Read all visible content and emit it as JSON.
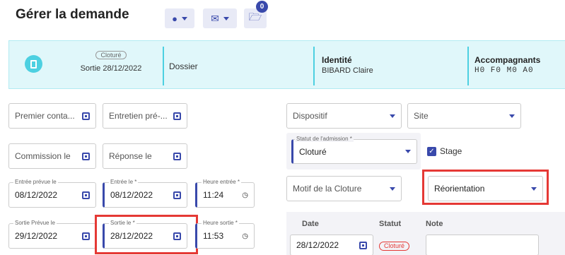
{
  "header": {
    "title": "Gérer la demande",
    "badge_count": "0"
  },
  "summary": {
    "status_chip": "Cloturé",
    "exit_text": "Sortie 28/12/2022",
    "dossier_label": "Dossier",
    "identity_label": "Identité",
    "identity_value": "BIBARD Claire",
    "companions_label": "Accompagnants",
    "companions_value": "H0 F0 M0 A0"
  },
  "form": {
    "premier_contact_ph": "Premier conta...",
    "entretien_ph": "Entretien pré-...",
    "commission_ph": "Commission le",
    "reponse_ph": "Réponse le",
    "entree_prevue_label": "Entrée prévue le",
    "entree_prevue_value": "08/12/2022",
    "entree_label": "Entrée le *",
    "entree_value": "08/12/2022",
    "heure_entree_label": "Heure entrée *",
    "heure_entree_value": "11:24",
    "sortie_prevue_label": "Sortie Prévue le",
    "sortie_prevue_value": "29/12/2022",
    "sortie_label": "Sortie le *",
    "sortie_value": "28/12/2022",
    "heure_sortie_label": "Heure sortie *",
    "heure_sortie_value": "11:53",
    "dispositif_ph": "Dispositif",
    "site_ph": "Site",
    "statut_label": "Statut de l'admission *",
    "statut_value": "Cloturé",
    "stage_label": "Stage",
    "motif_ph": "Motif de la Cloture",
    "motif_value": "Réorientation"
  },
  "history": {
    "col_date": "Date",
    "col_statut": "Statut",
    "col_note": "Note",
    "rows": [
      {
        "date": "28/12/2022",
        "statut": "Cloturé"
      }
    ]
  },
  "colors": {
    "accent": "#3949ab",
    "highlight": "#e53935",
    "panel_bg": "#e0f7fa"
  }
}
